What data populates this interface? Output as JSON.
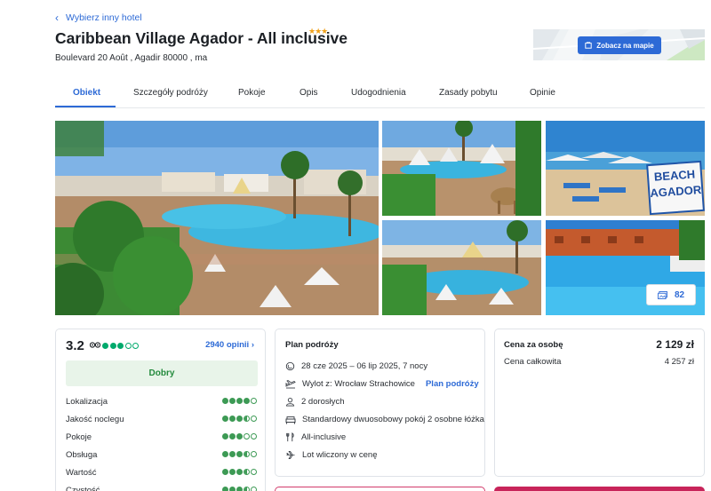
{
  "nav": {
    "back_label": "Wybierz inny hotel"
  },
  "hotel": {
    "name": "Caribbean Village Agador - All inclusive",
    "stars": "★★★",
    "address": "Boulevard 20 Août , Agadir 80000 , ma"
  },
  "map": {
    "button_label": "Zobacz na mapie"
  },
  "tabs": [
    {
      "label": "Obiekt"
    },
    {
      "label": "Szczegóły podróży"
    },
    {
      "label": "Pokoje"
    },
    {
      "label": "Opis"
    },
    {
      "label": "Udogodnienia"
    },
    {
      "label": "Zasady pobytu"
    },
    {
      "label": "Opinie"
    }
  ],
  "gallery": {
    "count": "82"
  },
  "beach_sign": {
    "line1": "BEACH",
    "line2": "AGADOR"
  },
  "rating": {
    "score": "3.2",
    "tripadvisor_level": 3,
    "reviews_label": "2940 opinii",
    "grade": "Dobry",
    "categories": [
      {
        "label": "Lokalizacja",
        "value": 4
      },
      {
        "label": "Jakość noclegu",
        "value": 3.5
      },
      {
        "label": "Pokoje",
        "value": 3
      },
      {
        "label": "Obsługa",
        "value": 3.5
      },
      {
        "label": "Wartość",
        "value": 3.5
      },
      {
        "label": "Czystość",
        "value": 3.5
      }
    ]
  },
  "plan": {
    "title": "Plan podróży",
    "dates": "28 cze 2025 – 06 lip 2025, 7 nocy",
    "departure": "Wylot z: Wrocław Strachowice",
    "plan_link": "Plan podróży",
    "guests": "2 dorosłych",
    "room": "Standardowy dwuosobowy pokój 2 osobne łóżka",
    "board": "All-inclusive",
    "flight": "Lot wliczony w cenę"
  },
  "price": {
    "per_person_label": "Cena za osobę",
    "per_person_value": "2 129 zł",
    "total_label": "Cena całkowita",
    "total_value": "4 257 zł"
  }
}
